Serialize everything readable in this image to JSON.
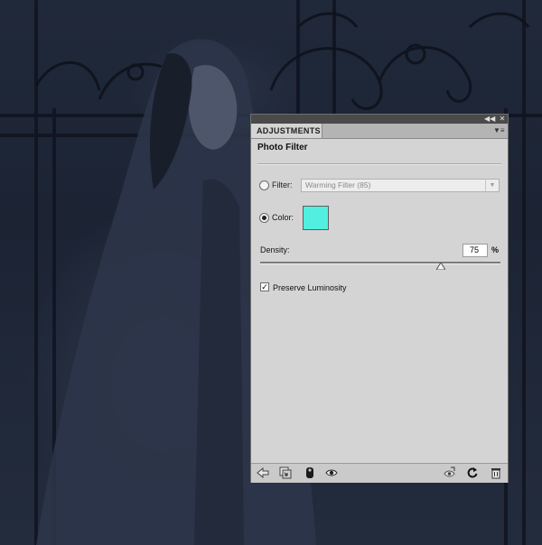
{
  "panel": {
    "tab_label": "ADJUSTMENTS",
    "collapse_icon": "double-chevron-left-icon",
    "close_icon": "close-icon",
    "menu_icon": "panel-menu-icon",
    "title": "Photo Filter",
    "filter": {
      "label": "Filter:",
      "selected": false,
      "value": "Warming Filter (85)"
    },
    "color": {
      "label": "Color:",
      "selected": true,
      "swatch": "#52efe0"
    },
    "density": {
      "label": "Density:",
      "value": "75",
      "unit": "%",
      "percent": 75
    },
    "preserve_luminosity": {
      "label": "Preserve Luminosity",
      "checked": true
    },
    "footer_icons": [
      "back-arrow-icon",
      "clip-to-layer-icon",
      "layer-mask-icon",
      "visibility-eye-icon",
      "view-previous-state-icon",
      "reset-icon",
      "delete-trash-icon"
    ]
  },
  "colors": {
    "panel_bg": "#d4d4d4",
    "titlebar": "#4a4a4a",
    "canvas_bg": "#1b2232"
  }
}
